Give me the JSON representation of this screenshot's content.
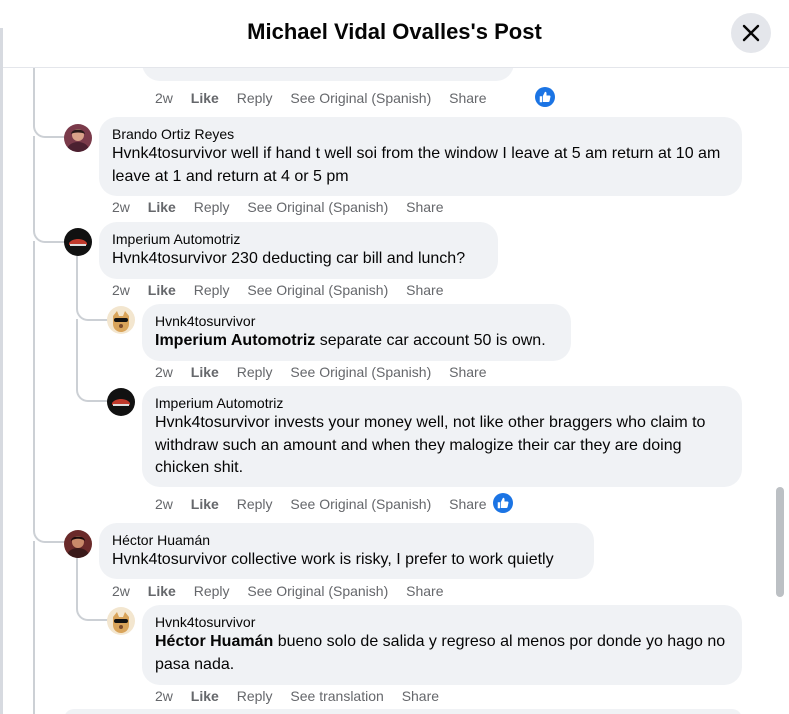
{
  "header": {
    "title": "Michael Vidal Ovalles's Post"
  },
  "top_comment": {
    "actions": {
      "time": "2w",
      "like": "Like",
      "reply": "Reply",
      "translate": "See Original (Spanish)",
      "share": "Share"
    }
  },
  "comments": [
    {
      "author": "Brando Ortiz Reyes",
      "text": "Hvnk4tosurvivor well if hand t well soi from the window I leave at 5 am return at 10 am leave at 1 and return at 4 or 5 pm",
      "actions": {
        "time": "2w",
        "like": "Like",
        "reply": "Reply",
        "translate": "See Original (Spanish)",
        "share": "Share"
      }
    },
    {
      "author": "Imperium Automotriz",
      "text": "Hvnk4tosurvivor 230 deducting car bill and lunch?",
      "actions": {
        "time": "2w",
        "like": "Like",
        "reply": "Reply",
        "translate": "See Original (Spanish)",
        "share": "Share"
      }
    },
    {
      "author": "Hvnk4tosurvivor",
      "mention": "Imperium Automotriz",
      "text": " separate car account 50 is own.",
      "actions": {
        "time": "2w",
        "like": "Like",
        "reply": "Reply",
        "translate": "See Original (Spanish)",
        "share": "Share"
      }
    },
    {
      "author": "Imperium Automotriz",
      "text": "Hvnk4tosurvivor invests your money well, not like other braggers who claim to withdraw such an amount and when they malogize their car they are doing chicken shit.",
      "actions": {
        "time": "2w",
        "like": "Like",
        "reply": "Reply",
        "translate": "See Original (Spanish)",
        "share": "Share"
      }
    },
    {
      "author": "Héctor Huamán",
      "text": "Hvnk4tosurvivor collective work is risky, I prefer to work quietly",
      "actions": {
        "time": "2w",
        "like": "Like",
        "reply": "Reply",
        "translate": "See Original (Spanish)",
        "share": "Share"
      }
    },
    {
      "author": "Hvnk4tosurvivor",
      "mention": "Héctor Huamán",
      "text": " bueno solo de salida y regreso al menos por donde yo hago no pasa nada.",
      "actions": {
        "time": "2w",
        "like": "Like",
        "reply": "Reply",
        "translate": "See translation",
        "share": "Share"
      }
    }
  ],
  "colors": {
    "accent": "#1b74e4",
    "bubble": "#f0f2f5",
    "muted": "#65676b"
  }
}
